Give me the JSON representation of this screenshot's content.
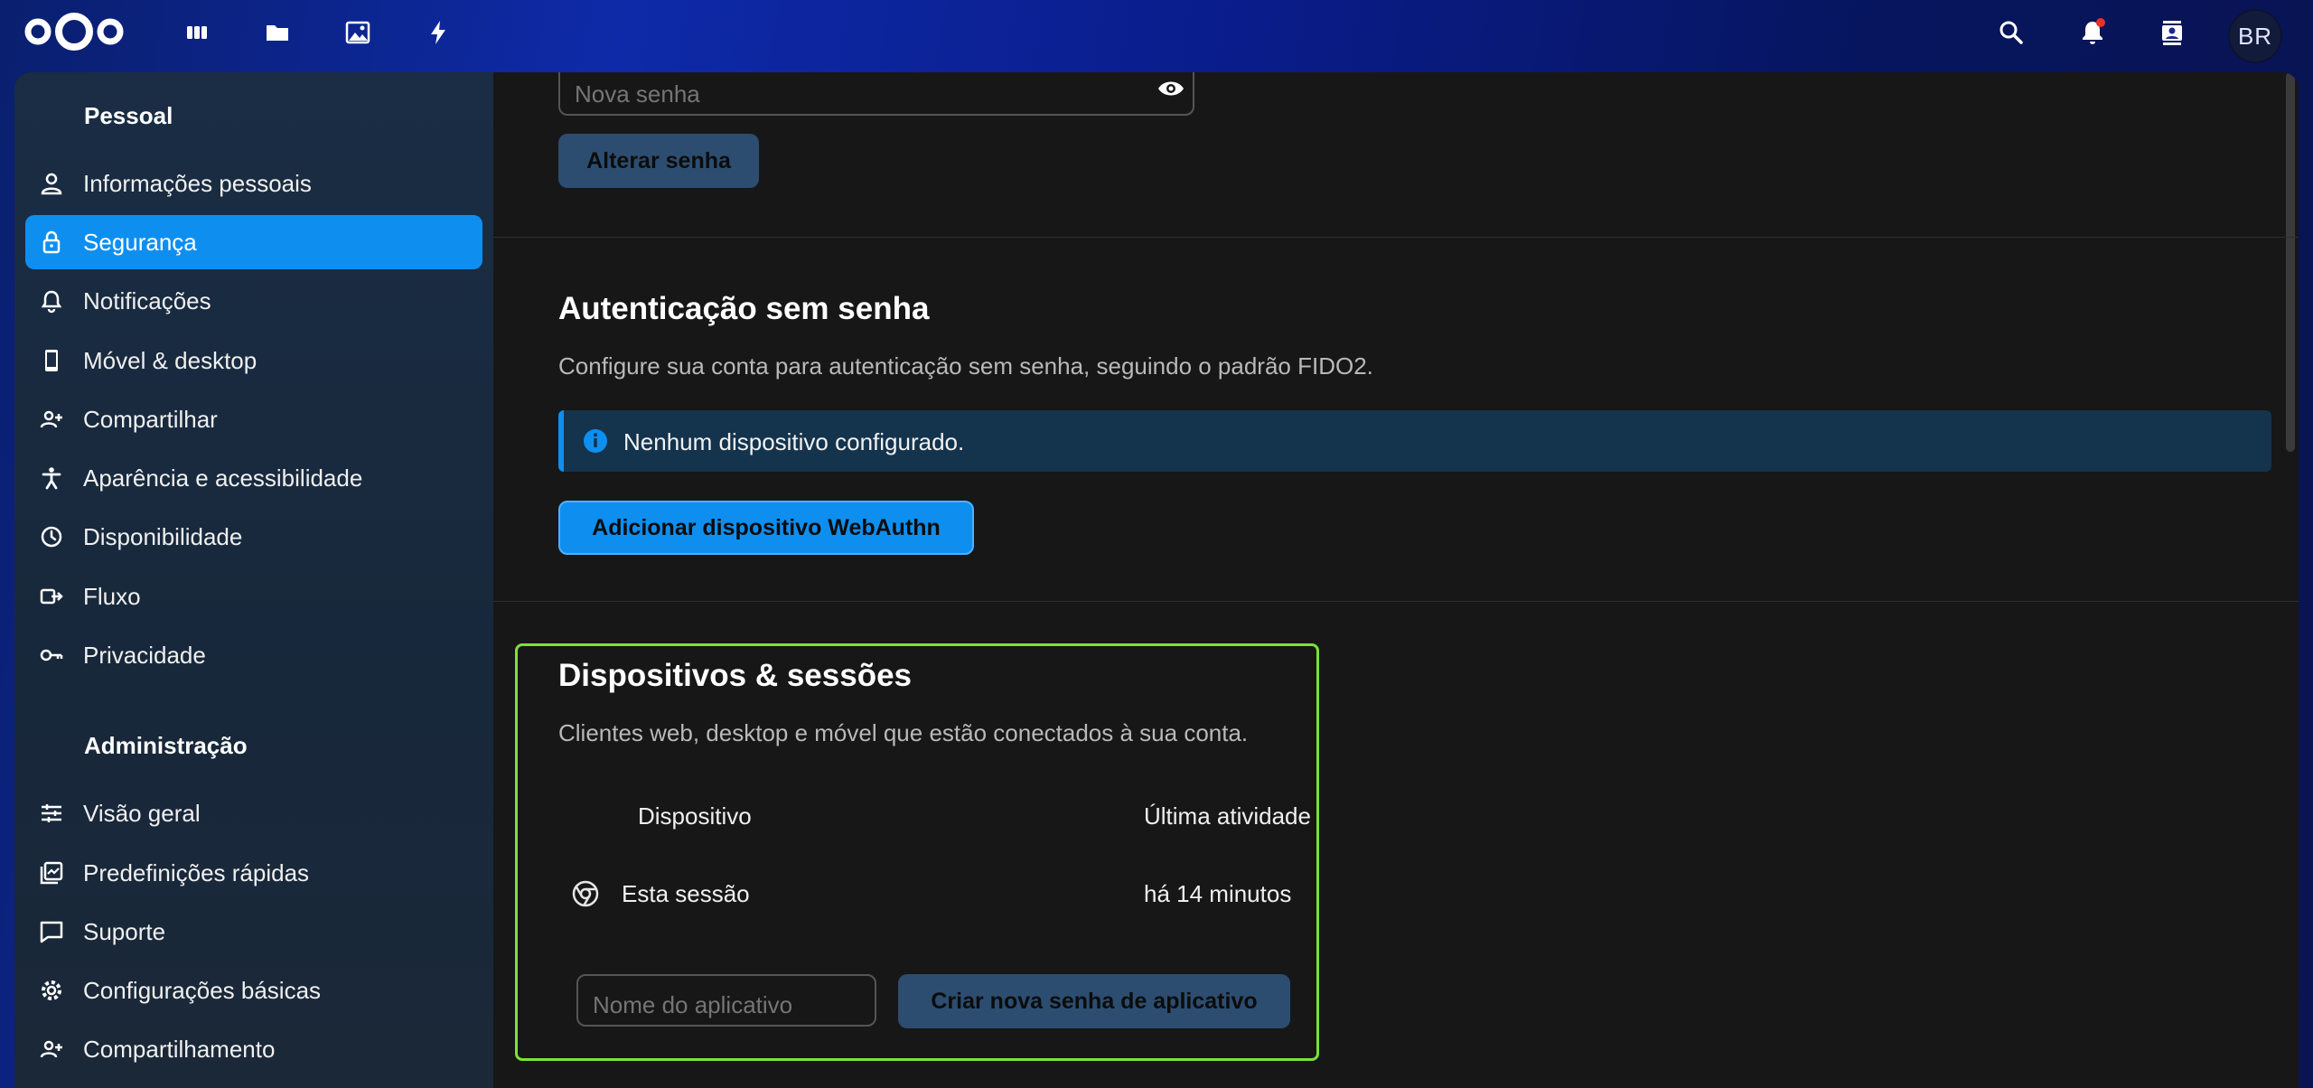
{
  "header": {
    "nav_icons": [
      "dashboard-icon",
      "files-icon",
      "photos-icon",
      "activity-icon"
    ],
    "right_icons": [
      "search-icon",
      "notifications-icon",
      "contacts-icon"
    ],
    "avatar_initials": "BR"
  },
  "sidebar": {
    "personal_heading": "Pessoal",
    "personal_items": [
      {
        "label": "Informações pessoais",
        "icon": "user-icon"
      },
      {
        "label": "Segurança",
        "icon": "lock-icon",
        "active": true
      },
      {
        "label": "Notificações",
        "icon": "bell-icon"
      },
      {
        "label": "Móvel & desktop",
        "icon": "phone-icon"
      },
      {
        "label": "Compartilhar",
        "icon": "user-plus-icon"
      },
      {
        "label": "Aparência e acessibilidade",
        "icon": "accessibility-icon"
      },
      {
        "label": "Disponibilidade",
        "icon": "clock-icon"
      },
      {
        "label": "Fluxo",
        "icon": "flow-icon"
      },
      {
        "label": "Privacidade",
        "icon": "key-icon"
      }
    ],
    "admin_heading": "Administração",
    "admin_items": [
      {
        "label": "Visão geral",
        "icon": "sliders-icon"
      },
      {
        "label": "Predefinições rápidas",
        "icon": "presets-icon"
      },
      {
        "label": "Suporte",
        "icon": "chat-icon"
      },
      {
        "label": "Configurações básicas",
        "icon": "gear-icon"
      },
      {
        "label": "Compartilhamento",
        "icon": "user-plus-icon"
      }
    ]
  },
  "password": {
    "new_password_placeholder": "Nova senha",
    "change_button": "Alterar senha"
  },
  "passwordless": {
    "title": "Autenticação sem senha",
    "description": "Configure sua conta para autenticação sem senha, seguindo o padrão FIDO2.",
    "info": "Nenhum dispositivo configurado.",
    "add_button": "Adicionar dispositivo WebAuthn"
  },
  "sessions": {
    "title": "Dispositivos & sessões",
    "description": "Clientes web, desktop e móvel que estão conectados à sua conta.",
    "col_device": "Dispositivo",
    "col_last_activity": "Última atividade",
    "rows": [
      {
        "device": "Esta sessão",
        "last_activity": "há 14 minutos",
        "icon": "chrome-icon"
      }
    ],
    "app_name_placeholder": "Nome do aplicativo",
    "create_button": "Criar nova senha de aplicativo"
  },
  "colors": {
    "accent": "#0e8ff0",
    "highlight_border": "#7ae23a",
    "muted_button": "#2c4d70",
    "info_background": "#14334d"
  }
}
